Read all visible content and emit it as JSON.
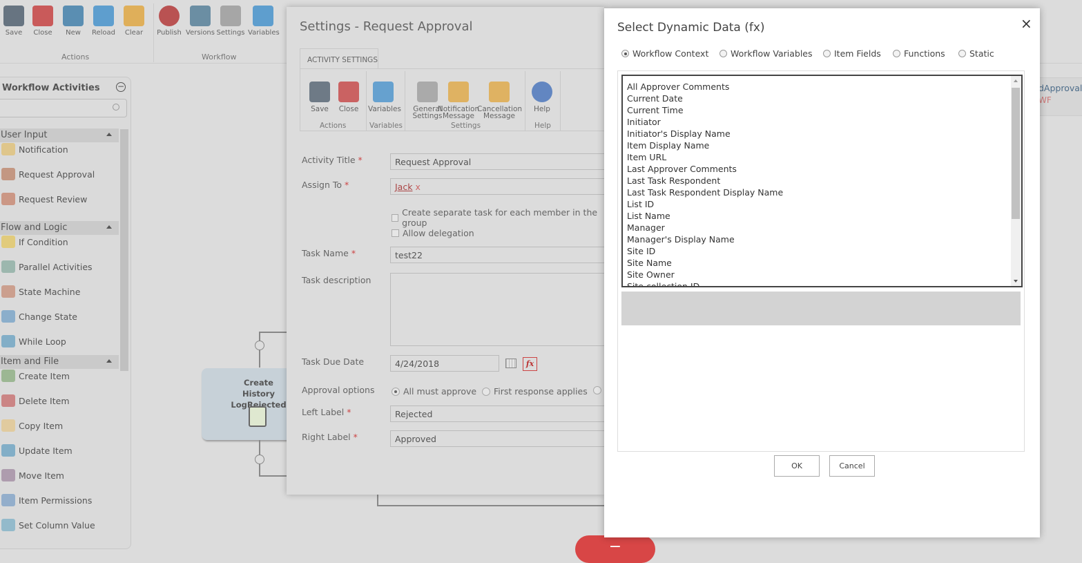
{
  "toolbar": {
    "buttons": [
      {
        "label": "Save",
        "icon": "save-icon",
        "color": "#4a5a6a"
      },
      {
        "label": "Close",
        "icon": "close-icon",
        "color": "#c43a3a"
      },
      {
        "label": "New",
        "icon": "new-icon",
        "color": "#3a7aa8"
      },
      {
        "label": "Reload",
        "icon": "reload-icon",
        "color": "#3f8ecb"
      },
      {
        "label": "Clear",
        "icon": "broom-icon",
        "color": "#e0a43a"
      },
      {
        "label": "Publish",
        "icon": "publish-icon",
        "color": "#b03030"
      },
      {
        "label": "Versions",
        "icon": "versions-icon",
        "color": "#4f7b95"
      },
      {
        "label": "Settings",
        "icon": "settings-icon",
        "color": "#999999"
      },
      {
        "label": "Variables",
        "icon": "variables-icon",
        "color": "#3f8ecb"
      }
    ],
    "groups": [
      "Actions",
      "Workflow"
    ]
  },
  "sidebar": {
    "title": "Workflow Activities",
    "search_placeholder": "",
    "sections": [
      {
        "label": "User Input",
        "items": [
          "Notification",
          "Request Approval",
          "Request Review"
        ]
      },
      {
        "label": "Flow and Logic",
        "items": [
          "If Condition",
          "Parallel Activities",
          "State Machine",
          "Change State",
          "While Loop"
        ]
      },
      {
        "label": "Item and File",
        "items": [
          "Create Item",
          "Delete Item",
          "Copy Item",
          "Update Item",
          "Move Item",
          "Item Permissions",
          "Set Column Value"
        ]
      }
    ]
  },
  "canvas": {
    "node_title": "Create History LogRejected",
    "node_title_line1": "Create History",
    "node_title_line2": "LogRejected",
    "right_text_1": "dApproval",
    "right_text_2": "WF"
  },
  "settings": {
    "title": "Settings - Request Approval",
    "tab": "ACTIVITY SETTINGS",
    "ribbon": [
      {
        "label": "Save"
      },
      {
        "label": "Close"
      },
      {
        "label": "Variables"
      },
      {
        "label": "General Settings"
      },
      {
        "label": "Notification Message"
      },
      {
        "label": "Cancellation Message"
      },
      {
        "label": "Help"
      }
    ],
    "ribbon_groups": [
      "Actions",
      "Variables",
      "Settings",
      "Help"
    ],
    "fields": {
      "activity_title_label": "Activity Title",
      "activity_title": "Request Approval",
      "assign_to_label": "Assign To",
      "assign_to": "Jack",
      "assign_remove": "x",
      "separate_task": "Create separate task for each member in the group",
      "allow_delegation": "Allow delegation",
      "task_name_label": "Task Name",
      "task_name": "test22",
      "task_description_label": "Task description",
      "task_description": "",
      "due_date_label": "Task Due Date",
      "due_date": "4/24/2018",
      "fx": "fx",
      "approval_options_label": "Approval options",
      "approval_options": [
        "All must approve",
        "First response applies"
      ],
      "approval_selected": "All must approve",
      "left_label_label": "Left Label",
      "left_label": "Rejected",
      "right_label_label": "Right Label",
      "right_label": "Approved",
      "required_mark": "*"
    }
  },
  "dynamic_dialog": {
    "title": "Select Dynamic Data (fx)",
    "close": "×",
    "options": [
      "Workflow Context",
      "Workflow Variables",
      "Item Fields",
      "Functions",
      "Static"
    ],
    "selected": "Workflow Context",
    "items": [
      "All Approver Comments",
      "Current Date",
      "Current Time",
      "Initiator",
      "Initiator's Display Name",
      "Item Display Name",
      "Item URL",
      "Last Approver Comments",
      "Last Task Respondent",
      "Last Task Respondent Display Name",
      "List ID",
      "List Name",
      "Manager",
      "Manager's Display Name",
      "Site ID",
      "Site Name",
      "Site Owner",
      "Site collection ID"
    ],
    "ok": "OK",
    "cancel": "Cancel"
  },
  "colors": {
    "accent_red": "#c44",
    "overlay": "#dcdcdc"
  }
}
